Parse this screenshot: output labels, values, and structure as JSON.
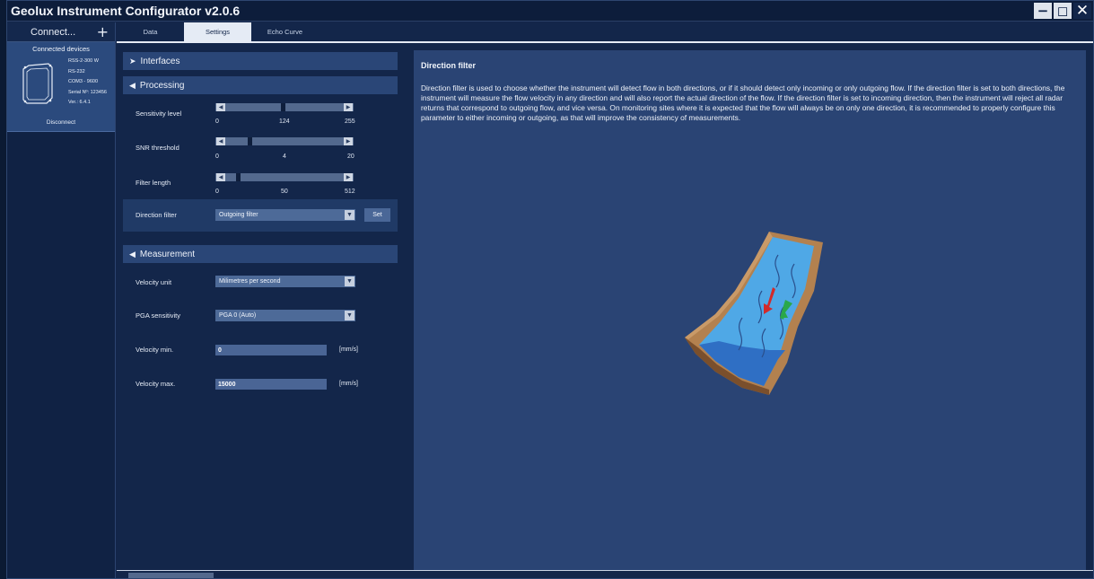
{
  "app": {
    "title": "Geolux Instrument Configurator v2.0.6"
  },
  "window_controls": {
    "minimize": "−",
    "maximize": "◻",
    "close": "✕"
  },
  "sidebar": {
    "connect_label": "Connect...",
    "add_symbol": "+",
    "connected_header": "Connected devices",
    "device": {
      "model": "RSS-2-300 W",
      "interface": "RS-232",
      "port": "COM3 - 9600",
      "serial": "Serial Nº: 123456",
      "version": "Ver.: 6.4.1",
      "disconnect_label": "Disconnect"
    }
  },
  "tabs": [
    {
      "label": "Data",
      "active": false
    },
    {
      "label": "Settings",
      "active": true
    },
    {
      "label": "Echo Curve",
      "active": false
    }
  ],
  "sections": {
    "interfaces": {
      "label": "Interfaces",
      "chevron": "➤"
    },
    "processing": {
      "label": "Processing",
      "chevron": "◀"
    },
    "measurement": {
      "label": "Measurement",
      "chevron": "◀"
    }
  },
  "processing": {
    "sensitivity": {
      "label": "Sensitivity level",
      "min": "0",
      "value": "124",
      "max": "255",
      "fraction": 0.486
    },
    "snr": {
      "label": "SNR threshold",
      "min": "0",
      "value": "4",
      "max": "20",
      "fraction": 0.2
    },
    "filter_length": {
      "label": "Filter length",
      "min": "0",
      "value": "50",
      "max": "512",
      "fraction": 0.098
    },
    "direction_filter": {
      "label": "Direction filter",
      "selected": "Outgoing filter",
      "set_label": "Set"
    }
  },
  "measurement": {
    "velocity_unit": {
      "label": "Velocity unit",
      "selected": "Milimetres per second"
    },
    "pga_sensitivity": {
      "label": "PGA sensitivity",
      "selected": "PGA 0 (Auto)"
    },
    "velocity_min": {
      "label": "Velocity min.",
      "value": "0",
      "unit": "[mm/s]"
    },
    "velocity_max": {
      "label": "Velocity max.",
      "value": "15000",
      "unit": "[mm/s]"
    }
  },
  "help": {
    "title": "Direction filter",
    "text": "Direction filter is used to choose whether the instrument will detect flow in both directions, or if it should detect only incoming or only outgoing flow. If the direction filter is set to both directions, the instrument will measure the flow velocity in any direction and will also report the actual direction of the flow. If the direction filter is set to incoming direction, then the instrument will reject all radar returns that correspond to outgoing flow, and vice versa. On monitoring sites where it is expected that the flow will always be on only one direction, it is recommended to properly configure this parameter to either incoming or outgoing, as that will improve the consistency of measurements."
  },
  "colors": {
    "background": "#13264a",
    "panel": "#2a4474",
    "accent": "#e5ebf5",
    "water": "#4fa8e6",
    "earth": "#b3814f",
    "arrow_out": "#d22a2a",
    "arrow_in": "#2aa84a"
  }
}
